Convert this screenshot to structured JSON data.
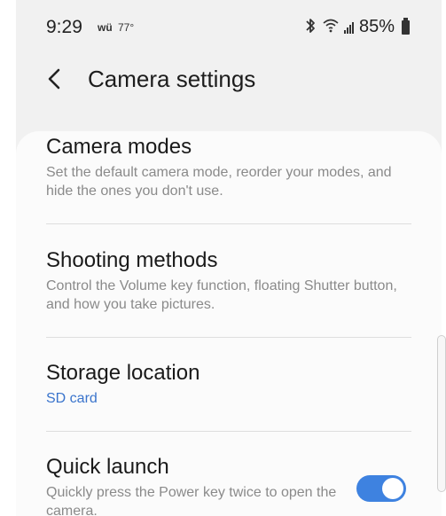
{
  "status_bar": {
    "time": "9:29",
    "notification_icon_text": "wü",
    "temperature": "77°",
    "battery_percent": "85%",
    "icons": [
      "bluetooth-icon",
      "wifi-icon",
      "signal-icon",
      "battery-icon"
    ]
  },
  "header": {
    "back_icon": "chevron-left-icon",
    "title": "Camera settings"
  },
  "settings": [
    {
      "title": "Camera modes",
      "description": "Set the default camera mode, reorder your modes, and hide the ones you don't use."
    },
    {
      "title": "Shooting methods",
      "description": "Control the Volume key function, floating Shutter button, and how you take pictures."
    },
    {
      "title": "Storage location",
      "value": "SD card"
    },
    {
      "title": "Quick launch",
      "description": "Quickly press the Power key twice to open the camera.",
      "toggle_on": true
    }
  ],
  "colors": {
    "accent": "#3e82e0",
    "value_text": "#3a74cc",
    "background": "#f1f1f1",
    "card": "#fbfbfb"
  }
}
